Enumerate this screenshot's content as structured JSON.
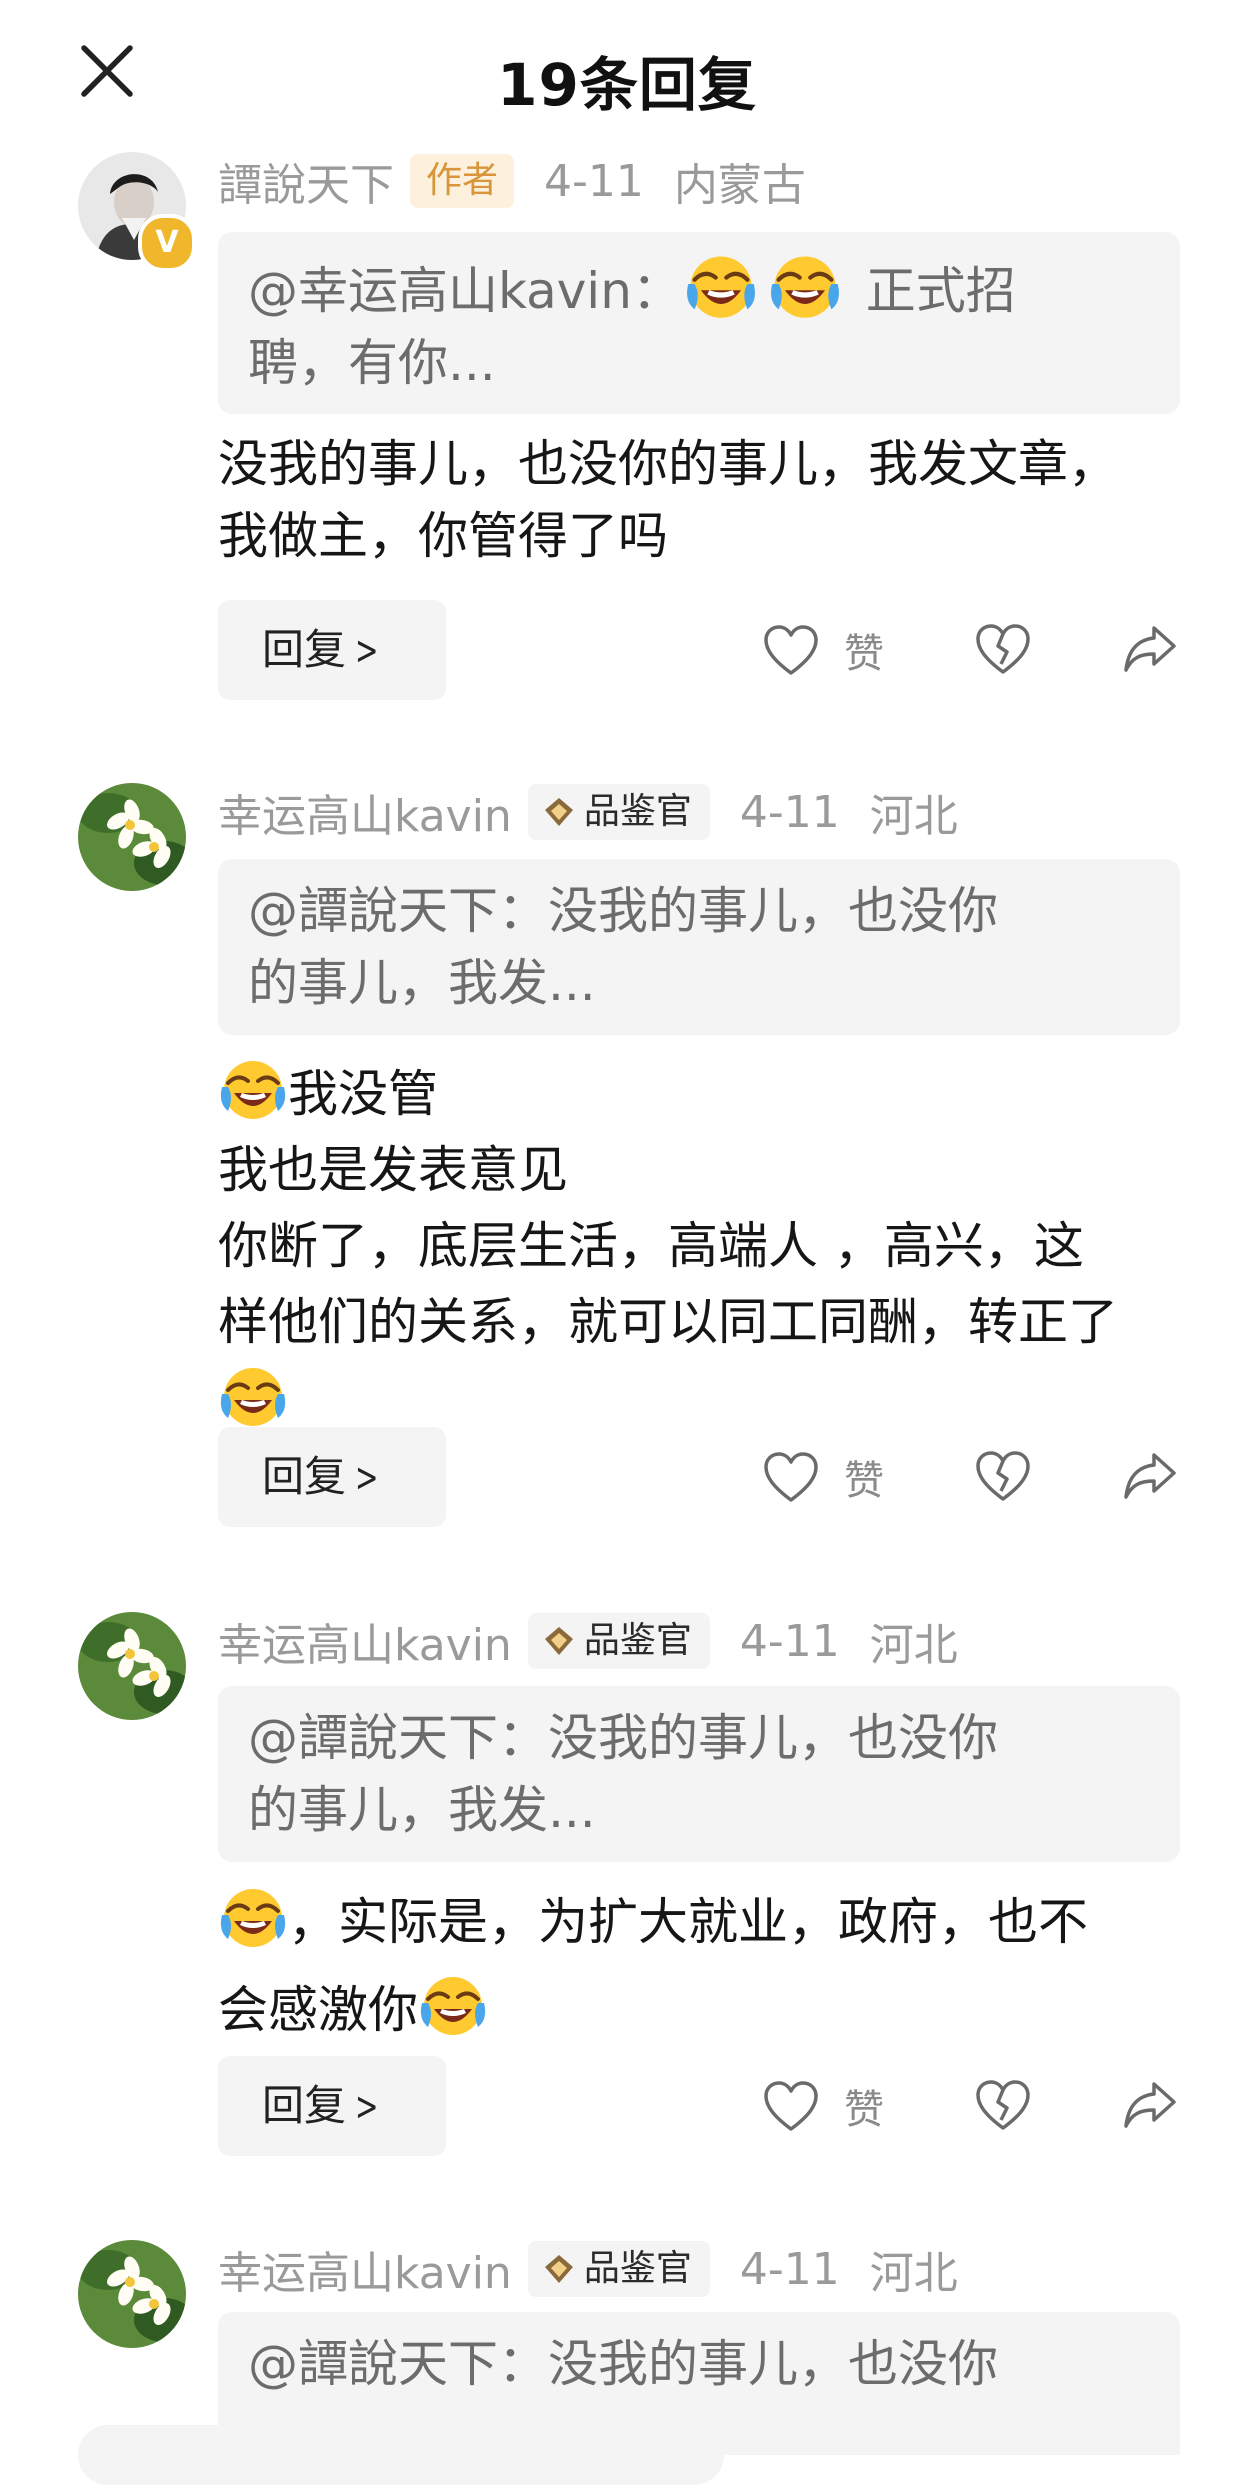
{
  "header": {
    "title": "19条回复"
  },
  "comments": [
    {
      "author": "譚說天下",
      "tag": "作者",
      "date": "4-11",
      "location": "内蒙古",
      "quote_prefix": "@幸运高山kavin：",
      "quote_suffix": "正式招",
      "quote_line2": "聘，有你...",
      "body_line1": "没我的事儿，也没你的事儿，我发文章，",
      "body_line2": "我做主，你管得了吗",
      "reply_label": "回复",
      "like_label": "赞"
    },
    {
      "author": "幸运高山kavin",
      "tag": "品鉴官",
      "date": "4-11",
      "location": "河北",
      "quote_line1": "@譚說天下：没我的事儿，也没你",
      "quote_line2": "的事儿，我发...",
      "body_line1": "我没管",
      "body_line2": "我也是发表意见",
      "body_line3": "你断了，底层生活，高端人 ，高兴，这",
      "body_line4": "样他们的关系，就可以同工同酬，转正了",
      "reply_label": "回复",
      "like_label": "赞"
    },
    {
      "author": "幸运高山kavin",
      "tag": "品鉴官",
      "date": "4-11",
      "location": "河北",
      "quote_line1": "@譚說天下：没我的事儿，也没你",
      "quote_line2": "的事儿，我发...",
      "body_line1": "，实际是，为扩大就业，政府，也不",
      "body_line2": "会感激你",
      "reply_label": "回复",
      "like_label": "赞"
    },
    {
      "author": "幸运高山kavin",
      "tag": "品鉴官",
      "date": "4-11",
      "location": "河北",
      "quote_line1": "@譚說天下：没我的事儿，也没你"
    }
  ],
  "icons": {
    "close": "close-icon",
    "like": "heart-icon",
    "dislike": "broken-heart-icon",
    "share": "share-icon",
    "emoji": "laughing-crying-emoji",
    "critic_badge": "diamond-badge-icon",
    "verified": "verified-v-icon"
  },
  "colors": {
    "meta_gray": "#9a9a9a",
    "author_tag_bg": "#fdf0dc",
    "author_tag_text": "#d8953a",
    "quote_bg": "#f4f4f4",
    "verified_badge": "#f0b72c"
  }
}
